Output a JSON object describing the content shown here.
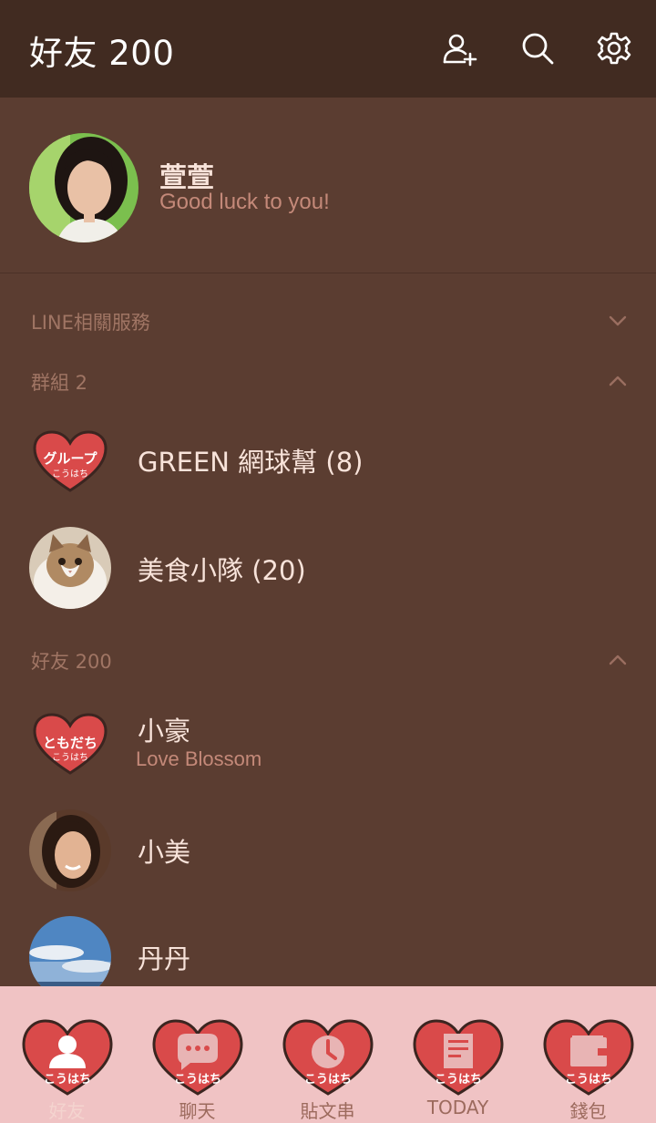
{
  "header": {
    "title": "好友 200",
    "icons": [
      "add-friend-icon",
      "search-icon",
      "settings-icon"
    ]
  },
  "profile": {
    "name": "萱萱",
    "status": "Good luck to you!"
  },
  "sections": {
    "line_services": "LINE相關服務",
    "groups": "群組 2",
    "friends": "好友 200"
  },
  "groups": [
    {
      "name": "GREEN 網球幫 (8)",
      "badge_text": "グループ",
      "badge_sub": "こうはち"
    },
    {
      "name": "美食小隊 (20)"
    }
  ],
  "friends": [
    {
      "name": "小豪",
      "status": "Love Blossom",
      "badge_text": "ともだち",
      "badge_sub": "こうはち"
    },
    {
      "name": "小美"
    },
    {
      "name": "丹丹"
    }
  ],
  "tabs": [
    {
      "label": "好友",
      "icon": "person-icon",
      "sub": "こうはち"
    },
    {
      "label": "聊天",
      "icon": "chat-icon",
      "sub": "こうはち"
    },
    {
      "label": "貼文串",
      "icon": "clock-icon",
      "sub": "こうはち"
    },
    {
      "label": "TODAY",
      "icon": "news-icon",
      "sub": "こうはち"
    },
    {
      "label": "錢包",
      "icon": "wallet-icon",
      "sub": "こうはち"
    }
  ],
  "colors": {
    "header_bg": "#412b21",
    "body_bg": "#5b3d31",
    "accent_red": "#d94a4a",
    "tabbar_bg": "#f0c3c4"
  }
}
